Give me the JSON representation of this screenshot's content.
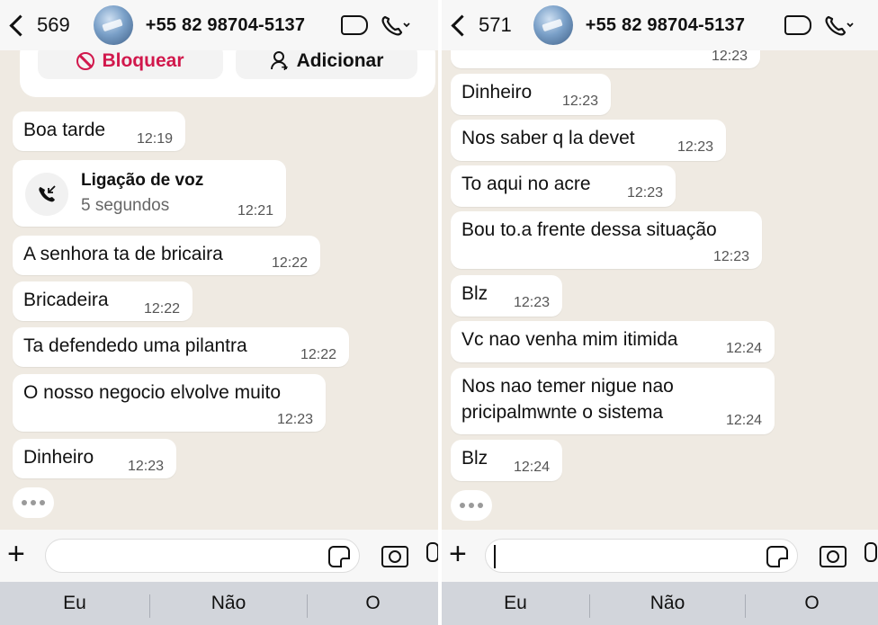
{
  "left": {
    "header": {
      "count": "569",
      "contact": "+55 82 98704-5137"
    },
    "actions": {
      "block": "Bloquear",
      "add": "Adicionar"
    },
    "messages": [
      {
        "text": "Boa tarde",
        "time": "12:19"
      },
      {
        "text": "A senhora ta de bricaira",
        "time": "12:22"
      },
      {
        "text": "Bricadeira",
        "time": "12:22"
      },
      {
        "text": "Ta defendedo uma pilantra",
        "time": "12:22"
      },
      {
        "text": "O nosso negocio elvolve muito",
        "time": "12:23"
      },
      {
        "text": "Dinheiro",
        "time": "12:23"
      }
    ],
    "call": {
      "title": "Ligação de voz",
      "duration": "5 segundos",
      "time": "12:21"
    },
    "suggestions": [
      "Eu",
      "Não",
      "O"
    ]
  },
  "right": {
    "header": {
      "count": "571",
      "contact": "+55 82 98704-5137"
    },
    "cut_time": "12:23",
    "messages": [
      {
        "text": "Dinheiro",
        "time": "12:23"
      },
      {
        "text": "Nos saber q la devet",
        "time": "12:23"
      },
      {
        "text": "To aqui no acre",
        "time": "12:23"
      },
      {
        "text": "Bou to.a frente dessa situação",
        "time": "12:23"
      },
      {
        "text": "Blz",
        "time": "12:23"
      },
      {
        "text": "Vc nao venha mim itimida",
        "time": "12:24"
      },
      {
        "line1": "Nos nao temer nigue nao",
        "line2": "pricipalmwnte o sistema",
        "time": "12:24"
      },
      {
        "text": "Blz",
        "time": "12:24"
      }
    ],
    "suggestions": [
      "Eu",
      "Não",
      "O"
    ]
  }
}
